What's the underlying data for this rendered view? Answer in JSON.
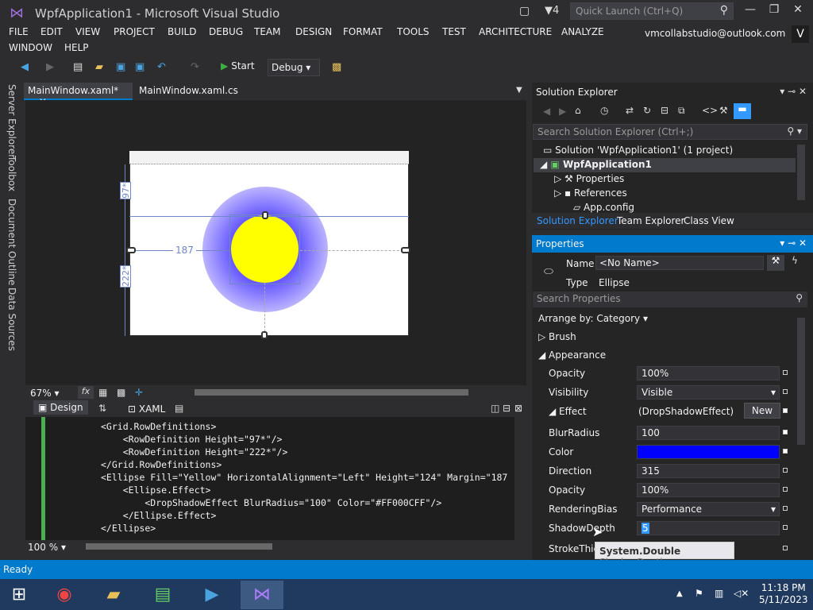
{
  "window": {
    "title": "WpfApplication1 - Microsoft Visual Studio",
    "notif_count": "4",
    "quick_launch": "Quick Launch (Ctrl+Q)"
  },
  "menu": [
    "FILE",
    "EDIT",
    "VIEW",
    "PROJECT",
    "BUILD",
    "DEBUG",
    "TEAM",
    "DESIGN",
    "FORMAT",
    "TOOLS",
    "TEST",
    "ARCHITECTURE",
    "ANALYZE",
    "WINDOW",
    "HELP"
  ],
  "account": {
    "email": "vmcollabstudio@outlook.com",
    "badge": "V"
  },
  "toolbar": {
    "start_label": "Start",
    "config": "Debug"
  },
  "left_rail": [
    "Server Explorer",
    "Toolbox",
    "Document Outline",
    "Data Sources"
  ],
  "doc_tabs": [
    {
      "label": "MainWindow.xaml*"
    },
    {
      "label": "MainWindow.xaml.cs"
    }
  ],
  "designer": {
    "row1": "97*",
    "row2": "222*",
    "margin_left": "187",
    "zoom": "67%"
  },
  "split": {
    "design_label": "Design",
    "xaml_label": "XAML"
  },
  "code": [
    "<Grid.RowDefinitions>",
    "    <RowDefinition Height=\"97*\"/>",
    "    <RowDefinition Height=\"222*\"/>",
    "</Grid.RowDefinitions>",
    "<Ellipse Fill=\"Yellow\" HorizontalAlignment=\"Left\" Height=\"124\" Margin=\"187",
    "    <Ellipse.Effect>",
    "        <DropShadowEffect BlurRadius=\"100\" Color=\"#FF000CFF\"/>",
    "    </Ellipse.Effect>",
    "</Ellipse>"
  ],
  "code_zoom": "100 %",
  "solution": {
    "title": "Solution Explorer",
    "search": "Search Solution Explorer (Ctrl+;)",
    "items": [
      "Solution 'WpfApplication1' (1 project)",
      "WpfApplication1",
      "Properties",
      "References",
      "App.config"
    ],
    "tabs": [
      "Solution Explorer",
      "Team Explorer",
      "Class View"
    ]
  },
  "properties": {
    "title": "Properties",
    "name_label": "Name",
    "name_value": "<No Name>",
    "type_label": "Type",
    "type_value": "Ellipse",
    "search": "Search Properties",
    "arrange": "Arrange by: Category",
    "cat_brush": "Brush",
    "cat_appearance": "Appearance",
    "rows": [
      {
        "label": "Opacity",
        "value": "100%"
      },
      {
        "label": "Visibility",
        "value": "Visible"
      },
      {
        "label": "Effect",
        "value": "(DropShadowEffect)"
      },
      {
        "label": "BlurRadius",
        "value": "100"
      },
      {
        "label": "Color",
        "value": ""
      },
      {
        "label": "Direction",
        "value": "315"
      },
      {
        "label": "Opacity",
        "value": "100%"
      },
      {
        "label": "RenderingBias",
        "value": "Performance"
      },
      {
        "label": "ShadowDepth",
        "value": "5"
      },
      {
        "label": "StrokeThickness",
        "value": ""
      }
    ],
    "new_button": "New",
    "color_swatch": "#0000ff",
    "tooltip_type": "System.Double",
    "tooltip_name": "ShadowDepth"
  },
  "status": "Ready",
  "clock": {
    "time": "11:18 PM",
    "date": "5/11/2023"
  }
}
